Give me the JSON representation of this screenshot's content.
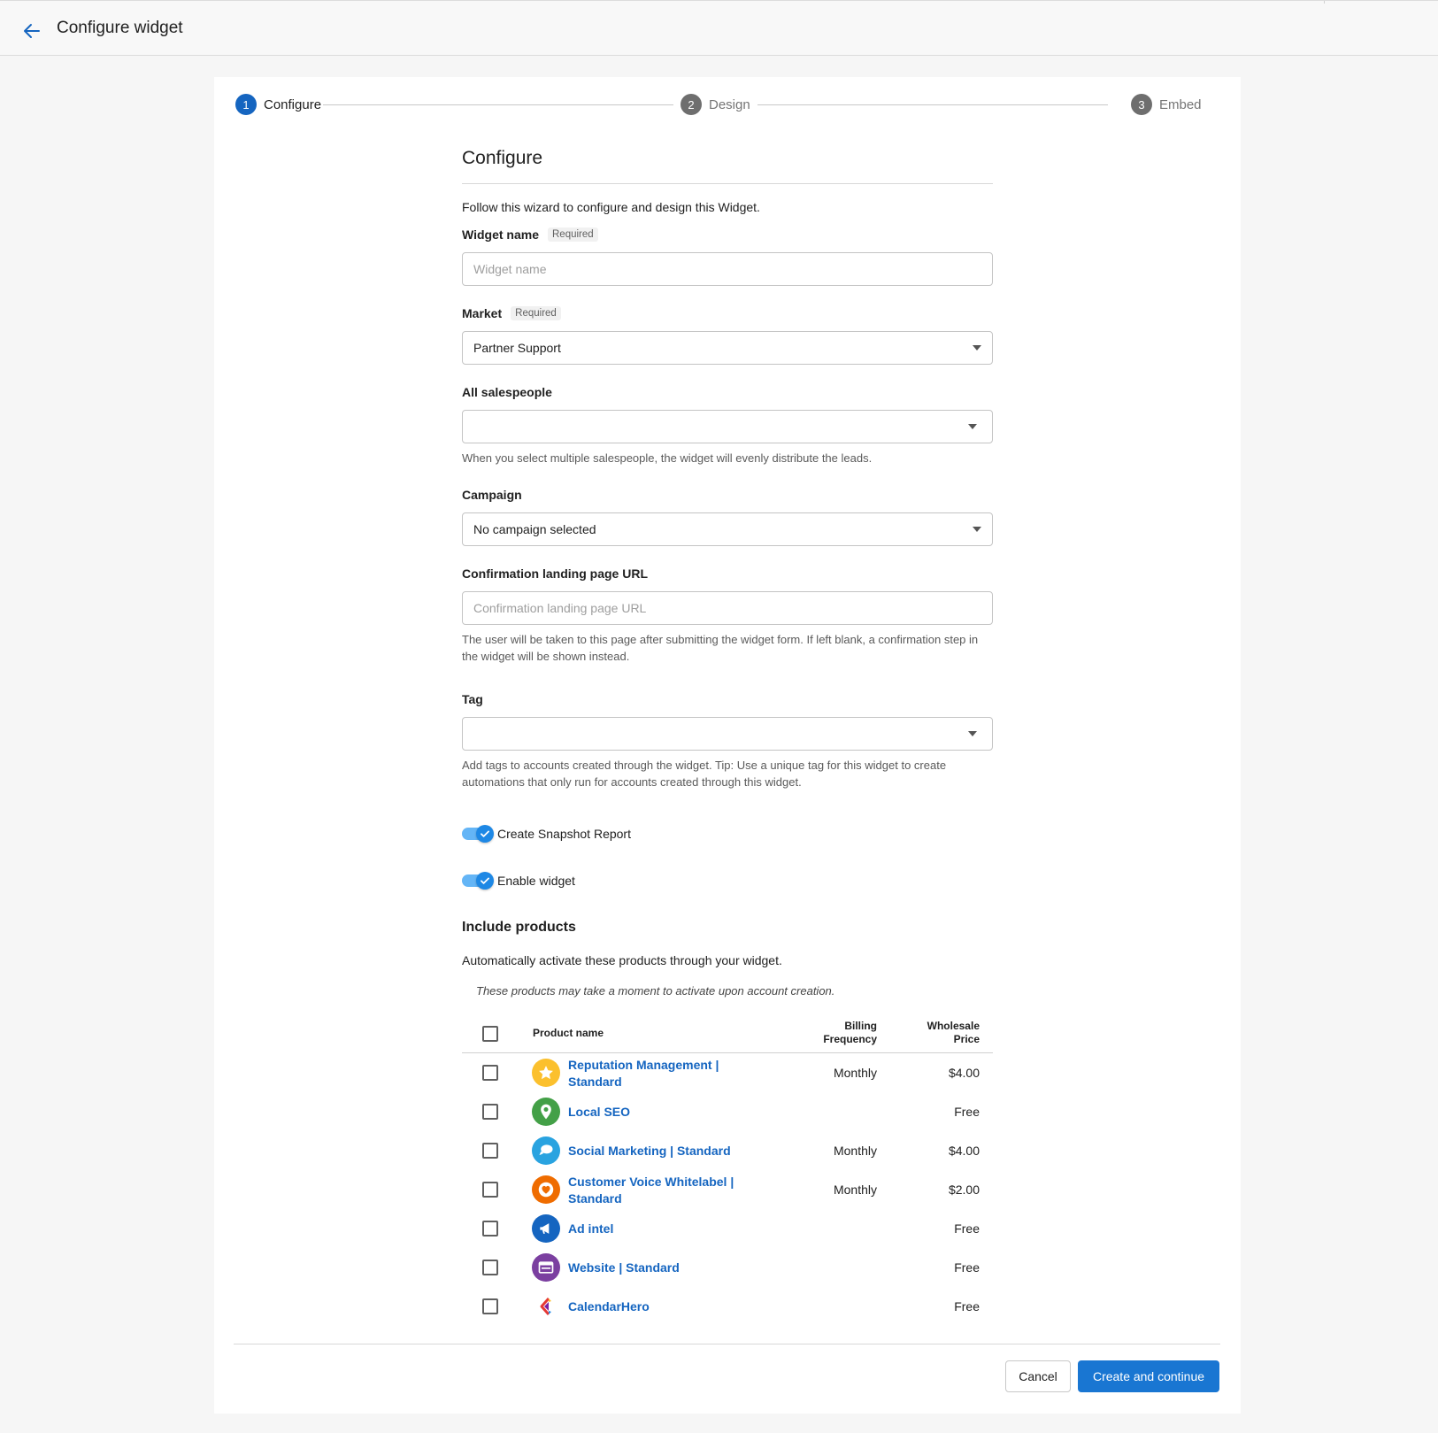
{
  "header": {
    "title": "Configure widget",
    "back_icon": "arrow-left-icon"
  },
  "stepper": {
    "steps": [
      {
        "number": "1",
        "label": "Configure",
        "state": "active"
      },
      {
        "number": "2",
        "label": "Design",
        "state": "inactive"
      },
      {
        "number": "3",
        "label": "Embed",
        "state": "inactive"
      }
    ]
  },
  "form": {
    "title": "Configure",
    "intro": "Follow this wizard to configure and design this Widget.",
    "widget_name": {
      "label": "Widget name",
      "required": "Required",
      "placeholder": "Widget name",
      "value": ""
    },
    "market": {
      "label": "Market",
      "required": "Required",
      "value": "Partner Support"
    },
    "salespeople": {
      "label": "All salespeople",
      "value": "",
      "hint": "When you select multiple salespeople, the widget will evenly distribute the leads."
    },
    "campaign": {
      "label": "Campaign",
      "value": "No campaign selected"
    },
    "confirmation_url": {
      "label": "Confirmation landing page URL",
      "placeholder": "Confirmation landing page URL",
      "value": "",
      "hint_line1": "The user will be taken to this page after submitting the widget form. If left blank, a confirmation step in",
      "hint_line2": "the widget will be shown instead."
    },
    "tag": {
      "label": "Tag",
      "value": "",
      "hint_line1": "Add tags to accounts created through the widget. Tip: Use a unique tag for this widget to create",
      "hint_line2": "automations that only run for accounts created through this widget."
    },
    "toggles": {
      "snapshot": {
        "label": "Create Snapshot Report",
        "checked": true
      },
      "enable": {
        "label": "Enable widget",
        "checked": true
      }
    }
  },
  "products": {
    "title": "Include products",
    "description": "Automatically activate these products through your widget.",
    "note": "These products may take a moment to activate upon account creation.",
    "columns": {
      "name": "Product name",
      "billing_1": "Billing",
      "billing_2": "Frequency",
      "price_1": "Wholesale",
      "price_2": "Price"
    },
    "rows": [
      {
        "name_1": "Reputation Management |",
        "name_2": "Standard",
        "billing": "Monthly",
        "price": "$4.00",
        "icon": "star-icon",
        "color": "#fbc02d"
      },
      {
        "name_1": "Local SEO",
        "name_2": "",
        "billing": "",
        "price": "Free",
        "icon": "map-pin-icon",
        "color": "#43a047"
      },
      {
        "name_1": "Social Marketing | Standard",
        "name_2": "",
        "billing": "Monthly",
        "price": "$4.00",
        "icon": "chat-bubble-icon",
        "color": "#29a3e0"
      },
      {
        "name_1": "Customer Voice Whitelabel |",
        "name_2": "Standard",
        "billing": "Monthly",
        "price": "$2.00",
        "icon": "heart-icon",
        "color": "#ef6c00"
      },
      {
        "name_1": "Ad intel",
        "name_2": "",
        "billing": "",
        "price": "Free",
        "icon": "megaphone-icon",
        "color": "#1565c0"
      },
      {
        "name_1": "Website | Standard",
        "name_2": "",
        "billing": "",
        "price": "Free",
        "icon": "browser-window-icon",
        "color": "#7b3fa0"
      },
      {
        "name_1": "CalendarHero",
        "name_2": "",
        "billing": "",
        "price": "Free",
        "icon": "calendarhero-logo-icon",
        "color": "#e53935"
      }
    ]
  },
  "footer": {
    "cancel": "Cancel",
    "primary": "Create and continue"
  }
}
